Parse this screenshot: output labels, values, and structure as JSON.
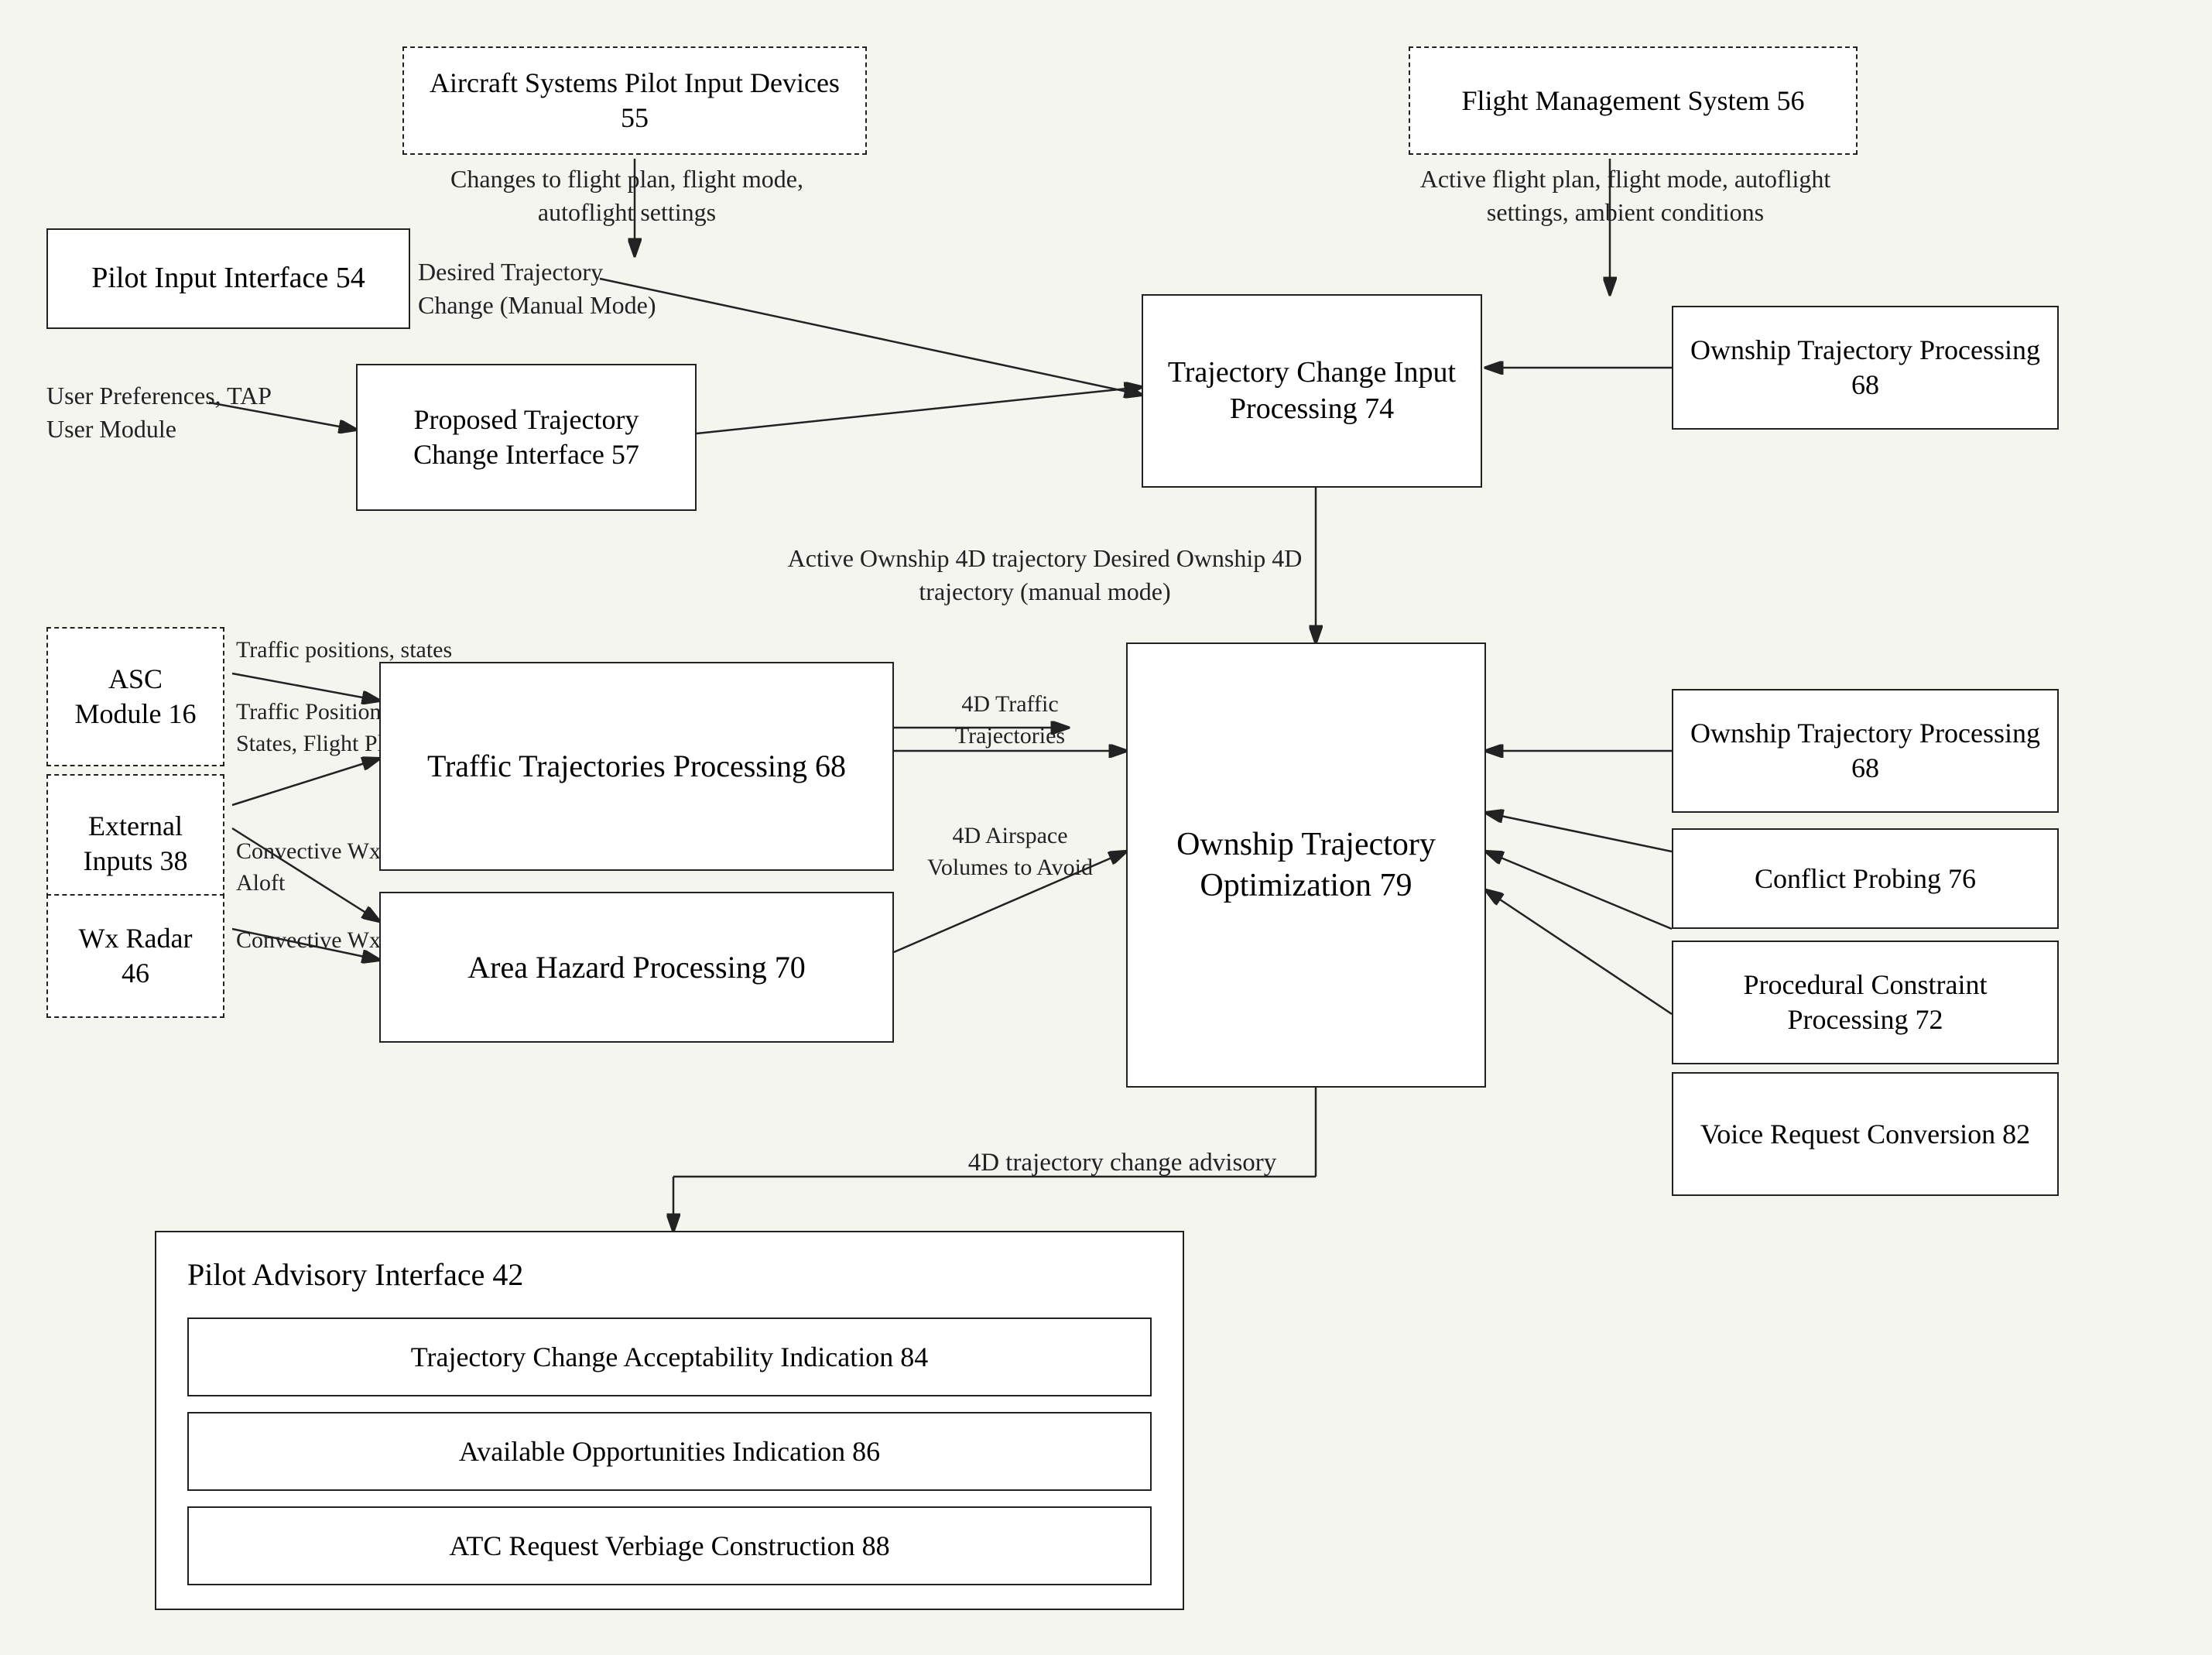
{
  "boxes": {
    "aircraft_pilot_devices": "Aircraft Systems Pilot Input Devices 55",
    "flight_management": "Flight Management System 56",
    "pilot_input_interface": "Pilot Input Interface 54",
    "trajectory_change_input": "Trajectory Change\nInput Processing 74",
    "ownship_trajectory_processing_top": "Ownship Trajectory\nProcessing 68",
    "proposed_trajectory": "Proposed Trajectory\nChange Interface 57",
    "ownship_trajectory_optimization": "Ownship Trajectory\nOptimization 79",
    "ownship_trajectory_processing_mid": "Ownship Trajectory\nProcessing 68",
    "conflict_probing": "Conflict Probing 76",
    "procedural_constraint": "Procedural Constraint\nProcessing 72",
    "voice_request": "Voice Request\nConversion 82",
    "asc_module": "ASC\nModule 16",
    "external_inputs": "External\nInputs 38",
    "wx_radar": "Wx Radar\n46",
    "traffic_trajectories": "Traffic Trajectories\nProcessing 68",
    "area_hazard": "Area Hazard\nProcessing 70",
    "pilot_advisory": "Pilot Advisory Interface 42",
    "trajectory_acceptability": "Trajectory Change Acceptability Indication 84",
    "available_opportunities": "Available Opportunities Indication 86",
    "atc_request": "ATC Request Verbiage Construction 88"
  },
  "labels": {
    "changes_flight": "Changes to flight plan, flight\nmode, autoflight settings",
    "active_flight": "Active flight plan, flight\nmode, autoflight settings,\nambient conditions",
    "desired_trajectory": "Desired Trajectory\nChange (Manual\nMode)",
    "user_preferences": "User Preferences,\nTAP User Module",
    "traffic_positions_states": "Traffic positions,\nstates",
    "traffic_positions_states_fp": "Traffic Positions,\nStates, Flight\nPlans",
    "convective_wx_winds": "Convective Wx,\nWinds Aloft",
    "convective_wx": "Convective Wx",
    "four_d_traffic": "4D Traffic\nTrajectories",
    "four_d_airspace": "4D\nAirspace\nVolumes to\nAvoid",
    "active_ownship": "Active Ownship 4D trajectory\nDesired Ownship 4D trajectory (manual mode)",
    "four_d_advisory": "4D trajectory change advisory"
  }
}
